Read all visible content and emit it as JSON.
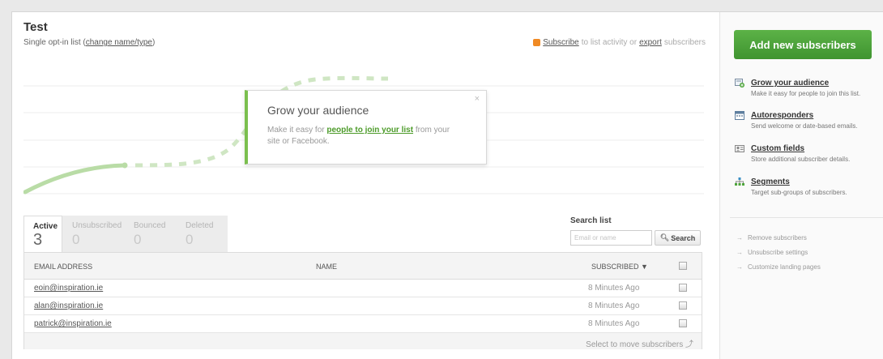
{
  "list": {
    "title": "Test",
    "subtitle_prefix": "Single opt-in list (",
    "change_link": "change name/type",
    "subtitle_suffix": ")",
    "subscribe_link": "Subscribe",
    "activity_text": "to list activity or",
    "export_link": "export",
    "export_suffix": "subscribers"
  },
  "popover": {
    "close": "×",
    "title": "Grow your audience",
    "text_prefix": "Make it easy for",
    "link": "people to join your list",
    "text_suffix": "from your site or Facebook."
  },
  "tabs": [
    {
      "label": "Active",
      "count": "3",
      "active": true
    },
    {
      "label": "Unsubscribed",
      "count": "0",
      "active": false
    },
    {
      "label": "Bounced",
      "count": "0",
      "active": false
    },
    {
      "label": "Deleted",
      "count": "0",
      "active": false
    }
  ],
  "search": {
    "label": "Search list",
    "placeholder": "Email or name",
    "button": "Search",
    "icon": "magnifier-icon"
  },
  "table": {
    "headers": {
      "email": "EMAIL ADDRESS",
      "name": "NAME",
      "subscribed": "SUBSCRIBED ▼"
    },
    "rows": [
      {
        "email": "eoin@inspiration.ie",
        "subscribed": "8 Minutes Ago"
      },
      {
        "email": "alan@inspiration.ie",
        "subscribed": "8 Minutes Ago"
      },
      {
        "email": "patrick@inspiration.ie",
        "subscribed": "8 Minutes Ago"
      }
    ],
    "footer": "Select to move subscribers ⤴"
  },
  "sidebar": {
    "add_button": "Add new subscribers",
    "features": [
      {
        "title": "Grow your audience",
        "desc": "Make it easy for people to join this list.",
        "icon": "grow-audience-icon"
      },
      {
        "title": "Autoresponders",
        "desc": "Send welcome or date-based emails.",
        "icon": "calendar-icon"
      },
      {
        "title": "Custom fields",
        "desc": "Store additional subscriber details.",
        "icon": "custom-fields-icon"
      },
      {
        "title": "Segments",
        "desc": "Target sub-groups of subscribers.",
        "icon": "segments-icon"
      }
    ],
    "links": [
      "Remove subscribers",
      "Unsubscribe settings",
      "Customize landing pages"
    ],
    "link_arrow": "→"
  },
  "colors": {
    "accent_green": "#4d9b2a",
    "button_green": "#4ea53b",
    "rss_orange": "#f08a24"
  }
}
